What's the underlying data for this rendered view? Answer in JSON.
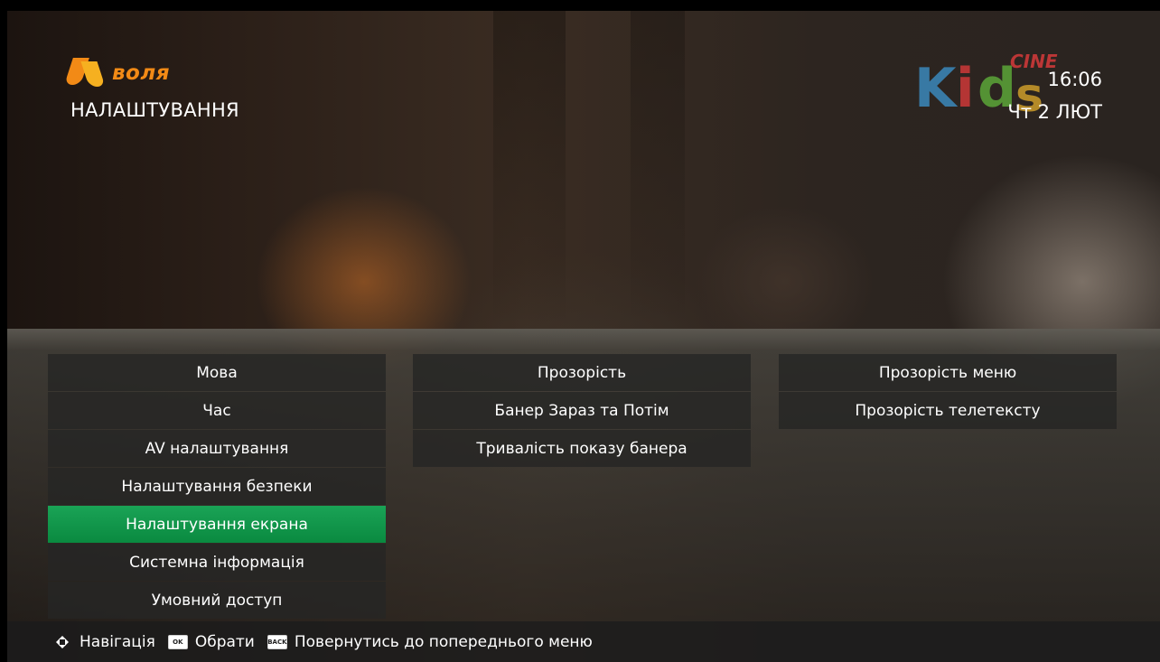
{
  "header": {
    "brand": "воля",
    "title": "НАЛАШТУВАННЯ",
    "time": "16:06",
    "date": "Чт 2 ЛЮТ"
  },
  "channel_logo": {
    "letters": [
      "K",
      "i",
      "d",
      "s"
    ],
    "cine": "CINE"
  },
  "menu": {
    "main_items": [
      {
        "label": "Мова"
      },
      {
        "label": "Час"
      },
      {
        "label": "AV налаштування"
      },
      {
        "label": "Налаштування безпеки"
      },
      {
        "label": "Налаштування екрана"
      },
      {
        "label": "Системна інформація"
      },
      {
        "label": "Умовний доступ"
      }
    ],
    "selected_main_index": 4,
    "sub_items": [
      {
        "label": "Прозорість"
      },
      {
        "label": "Банер Зараз та Потім"
      },
      {
        "label": "Тривалість показу банера"
      }
    ],
    "detail_items": [
      {
        "label": "Прозорість меню"
      },
      {
        "label": "Прозорість телетексту"
      }
    ]
  },
  "footer": {
    "navigate_label": "Навігація",
    "ok_key": "OK",
    "select_label": "Обрати",
    "back_key": "BACK",
    "back_label": "Повернутись до попереднього меню"
  },
  "colors": {
    "selected": "#0a8a40",
    "brand": "#f28a16"
  },
  "icons": {
    "navigation": "dpad-arrows-icon",
    "ok": "ok-key-icon",
    "back": "back-key-icon",
    "brand": "volia-logo-icon"
  }
}
